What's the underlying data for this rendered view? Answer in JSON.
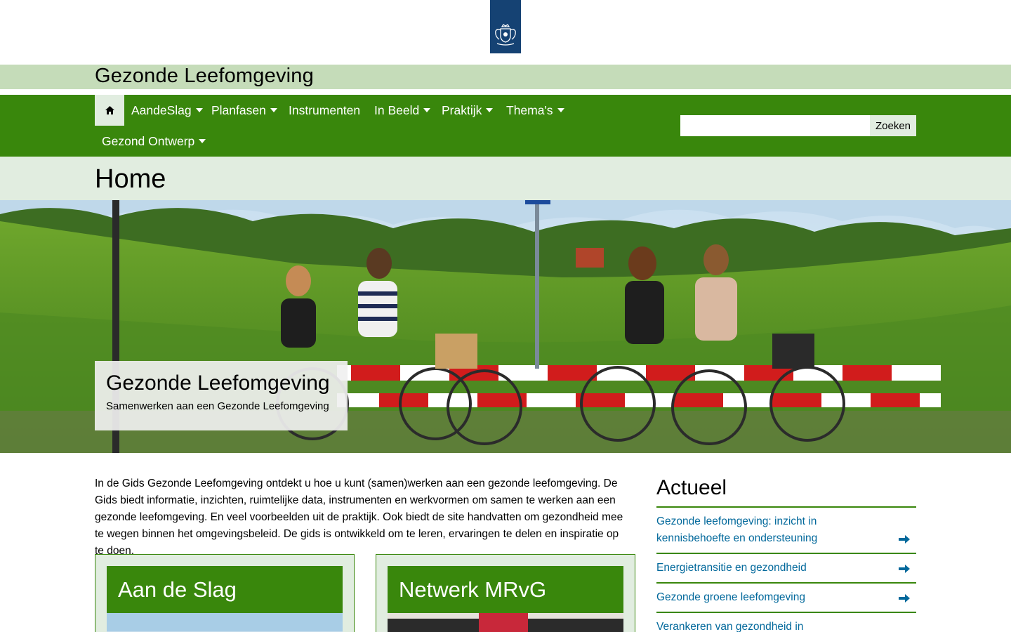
{
  "header": {
    "logo_icon": "rijksoverheid-crest-icon",
    "site_title": "Gezonde Leefomgeving"
  },
  "nav": {
    "home_icon": "home-icon",
    "items": [
      {
        "label": "AandeSlag",
        "dropdown": true
      },
      {
        "label": "Planfasen",
        "dropdown": true
      },
      {
        "label": "Instrumenten",
        "dropdown": false
      },
      {
        "label": "In Beeld",
        "dropdown": true
      },
      {
        "label": "Praktijk",
        "dropdown": true
      },
      {
        "label": "Thema's",
        "dropdown": true
      },
      {
        "label": "Gezond Ontwerp",
        "dropdown": true
      }
    ],
    "search": {
      "value": "",
      "button_label": "Zoeken"
    }
  },
  "page": {
    "title": "Home"
  },
  "hero": {
    "title": "Gezonde Leefomgeving",
    "subtitle": "Samenwerken aan een Gezonde Leefomgeving"
  },
  "intro": {
    "text": "In de Gids Gezonde Leefomgeving ontdekt u hoe u kunt (samen)werken aan een gezonde leefomgeving. De Gids biedt informatie, inzichten, ruimtelijke data, instrumenten en werkvormen om samen te werken aan een gezonde leefomgeving. En veel voorbeelden uit de praktijk. Ook biedt de site handvatten om gezondheid mee te wegen binnen het omgevingsbeleid. De gids is ontwikkeld om te leren, ervaringen te delen en inspiratie op te doen."
  },
  "cards": [
    {
      "title": "Aan de Slag"
    },
    {
      "title": "Netwerk MRvG"
    }
  ],
  "actueel": {
    "title": "Actueel",
    "items": [
      {
        "label": "Gezonde leefomgeving: inzicht in kennisbehoefte en ondersteuning"
      },
      {
        "label": "Energietransitie en gezondheid"
      },
      {
        "label": "Gezonde groene leefomgeving"
      },
      {
        "label": "Verankeren van gezondheid in omgevingsplannen"
      }
    ],
    "arrow_icon": "arrow-right-circle-icon"
  },
  "colors": {
    "brand_green": "#39870c",
    "light_green": "#c5dcb9",
    "pale_green": "#e1ede0",
    "link_blue": "#01689b",
    "logo_blue": "#154273"
  }
}
